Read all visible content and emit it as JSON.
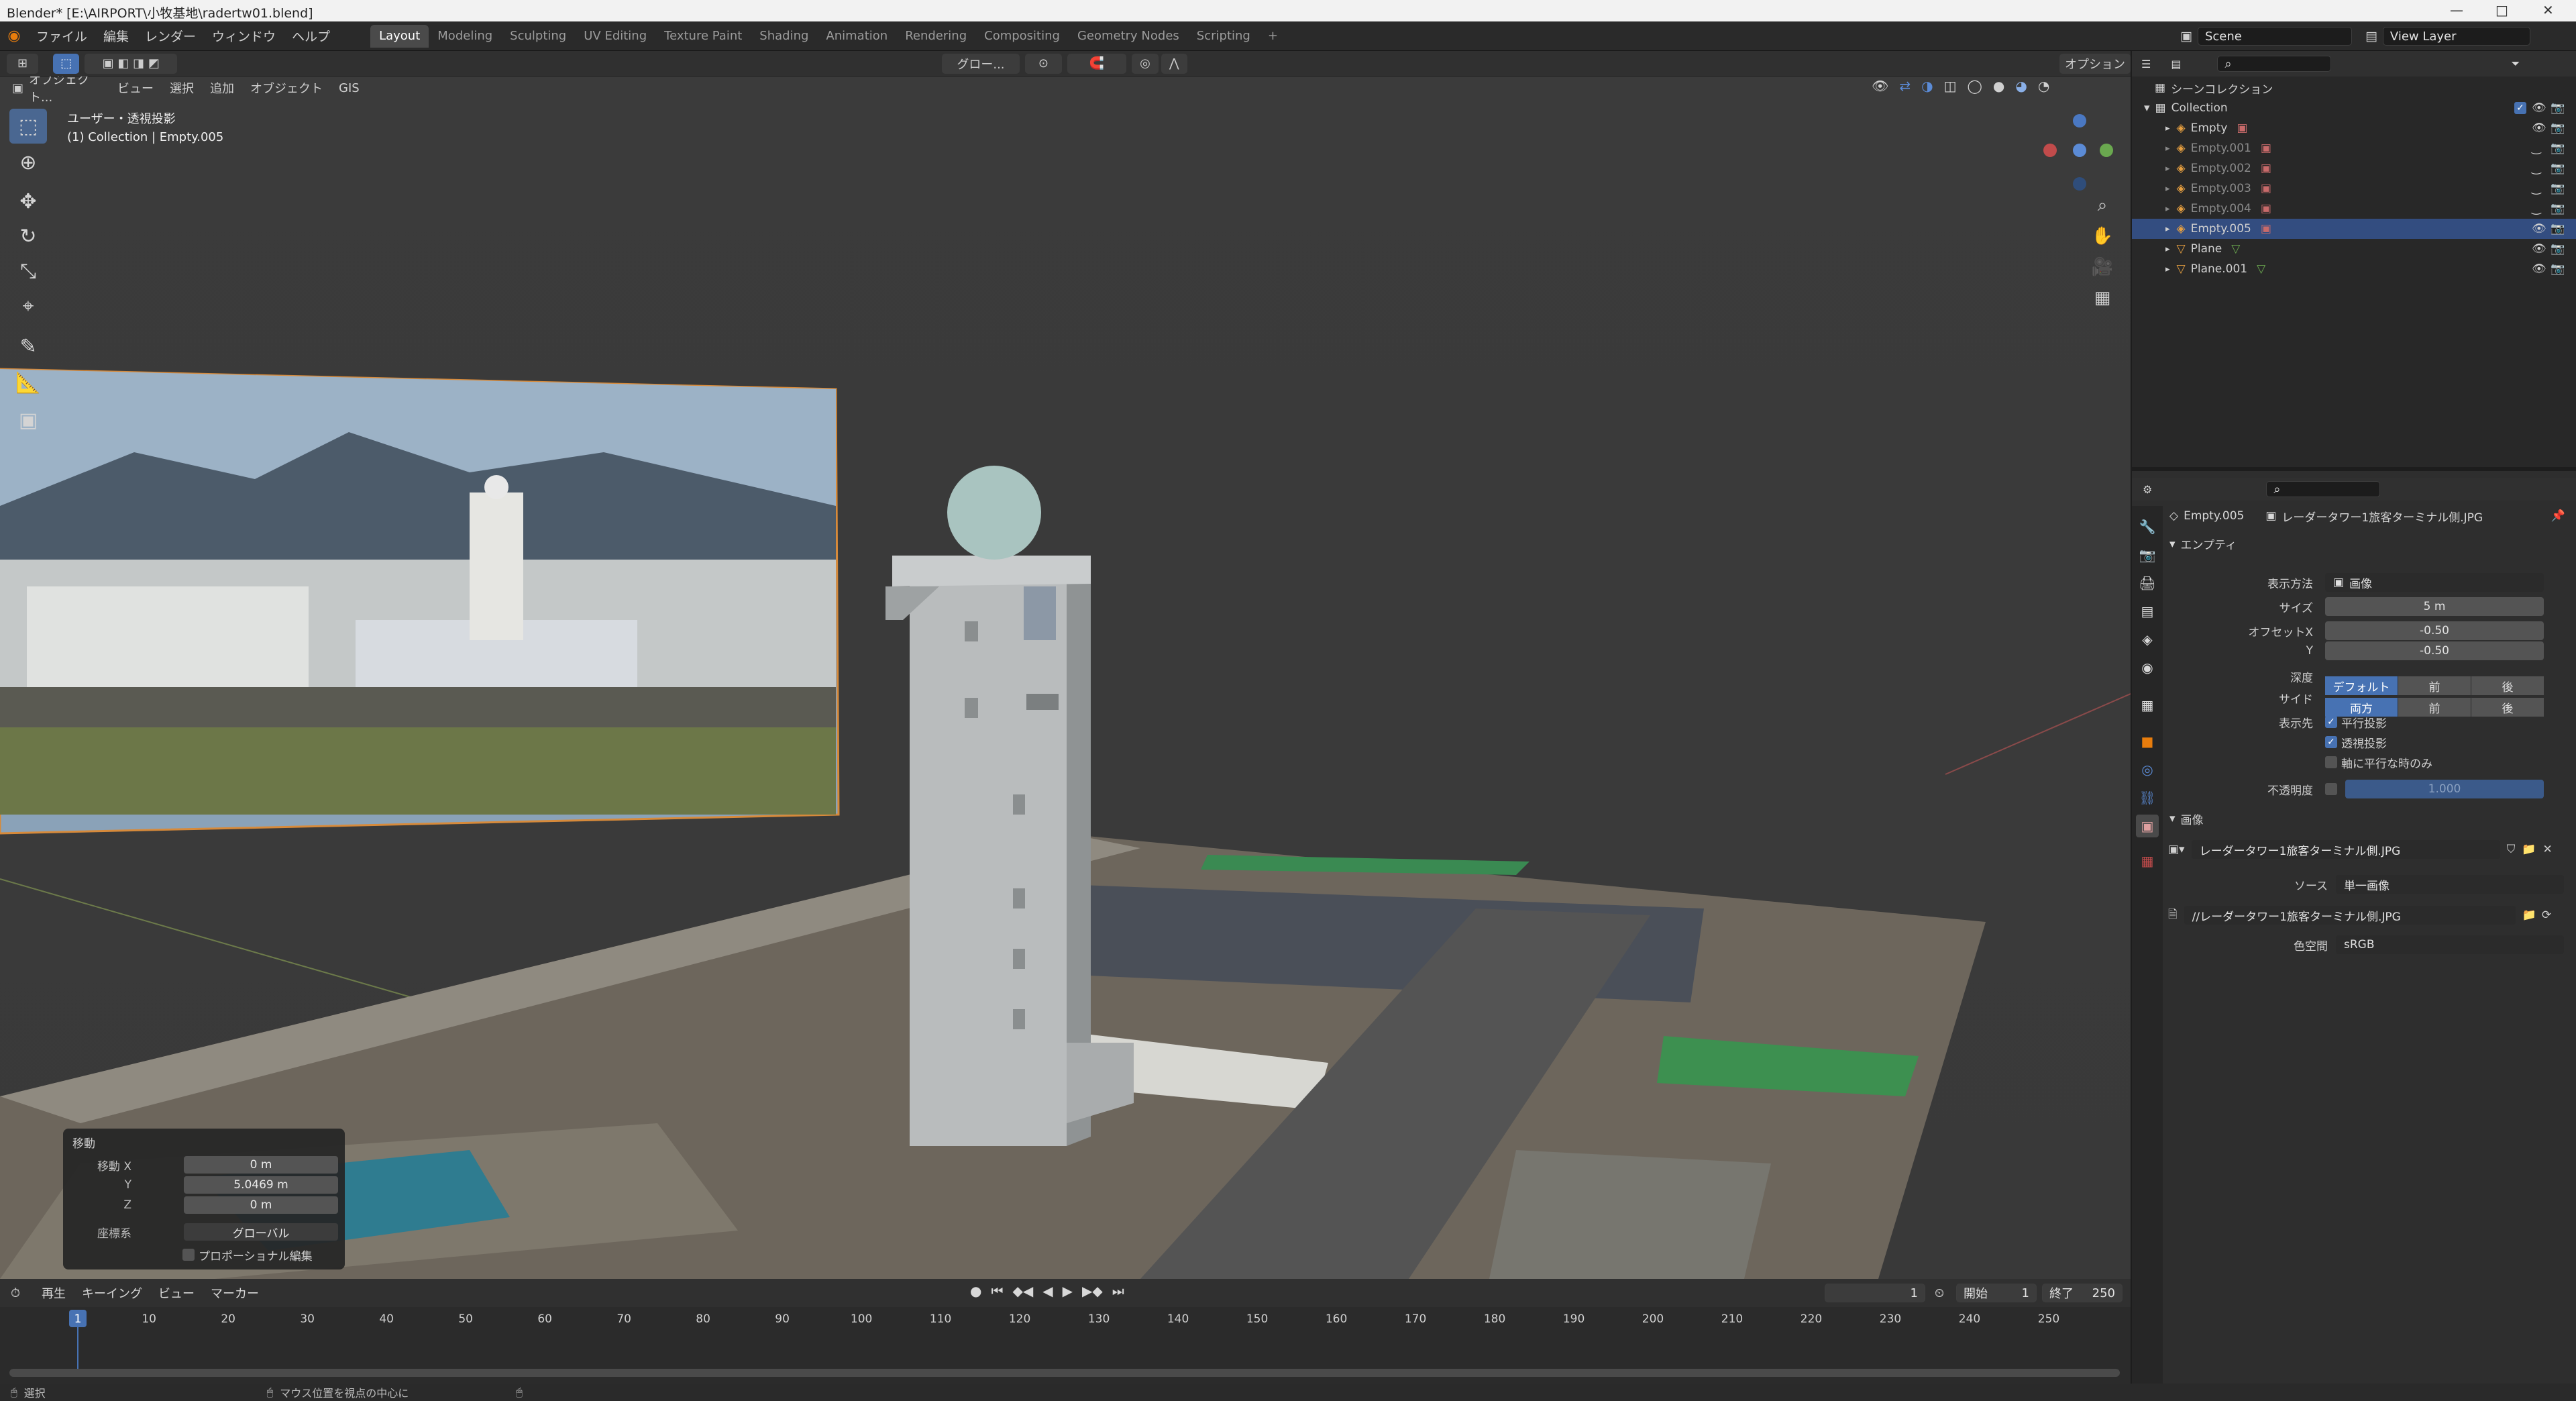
{
  "window": {
    "title": "Blender* [E:\\AIRPORT\\小牧基地\\radertw01.blend]",
    "minimize": "—",
    "maximize": "□",
    "close": "✕"
  },
  "menu": [
    "ファイル",
    "編集",
    "レンダー",
    "ウィンドウ",
    "ヘルプ"
  ],
  "workspaces": [
    "Layout",
    "Modeling",
    "Sculpting",
    "UV Editing",
    "Texture Paint",
    "Shading",
    "Animation",
    "Rendering",
    "Compositing",
    "Geometry Nodes",
    "Scripting"
  ],
  "workspace_add": "+",
  "scene": {
    "name": "Scene",
    "view_layer": "View Layer"
  },
  "header": {
    "transform_orientation": "グロー...",
    "options": "オプション"
  },
  "viewport_header": {
    "mode": "オブジェクト...",
    "menus": [
      "ビュー",
      "選択",
      "追加",
      "オブジェクト",
      "GIS"
    ]
  },
  "viewport": {
    "view_name": "ユーザー・透視投影",
    "collection_info": "(1) Collection | Empty.005",
    "tools": [
      "select",
      "cursor",
      "move",
      "rotate",
      "scale",
      "transform",
      "annotate",
      "measure",
      "add-cube"
    ]
  },
  "operator_panel": {
    "title": "移動",
    "rows": [
      {
        "label": "移動 X",
        "value": "0 m"
      },
      {
        "label": "Y",
        "value": "5.0469 m"
      },
      {
        "label": "Z",
        "value": "0 m"
      }
    ],
    "orientation_label": "座標系",
    "orientation_value": "グローバル",
    "proportional_label": "プロポーショナル編集"
  },
  "outliner": {
    "scene_collection": "シーンコレクション",
    "collection": "Collection",
    "items": [
      {
        "name": "Empty",
        "selected": false,
        "dim": false
      },
      {
        "name": "Empty.001",
        "selected": false,
        "dim": true
      },
      {
        "name": "Empty.002",
        "selected": false,
        "dim": true
      },
      {
        "name": "Empty.003",
        "selected": false,
        "dim": true
      },
      {
        "name": "Empty.004",
        "selected": false,
        "dim": true
      },
      {
        "name": "Empty.005",
        "selected": true,
        "dim": false
      },
      {
        "name": "Plane",
        "selected": false,
        "dim": false
      },
      {
        "name": "Plane.001",
        "selected": false,
        "dim": false
      }
    ]
  },
  "properties": {
    "object_name": "Empty.005",
    "image_name": "レーダータワー1旅客ターミナル側.JPG",
    "empty_section": "エンプティ",
    "display_as_label": "表示方法",
    "display_as_value": "画像",
    "size_label": "サイズ",
    "size_value": "5 m",
    "offset_x_label": "オフセットX",
    "offset_x_value": "-0.50",
    "offset_y_label": "Y",
    "offset_y_value": "-0.50",
    "depth_label": "深度",
    "depth_options": [
      "デフォルト",
      "前",
      "後"
    ],
    "side_label": "サイド",
    "side_options": [
      "両方",
      "前",
      "後"
    ],
    "show_label": "表示先",
    "show_options": [
      {
        "label": "平行投影",
        "checked": true
      },
      {
        "label": "透視投影",
        "checked": true
      },
      {
        "label": "軸に平行な時のみ",
        "checked": false
      }
    ],
    "opacity_label": "不透明度",
    "opacity_value": "1.000",
    "image_section": "画像",
    "image_block_name": "レーダータワー1旅客ターミナル側.JPG",
    "source_label": "ソース",
    "source_value": "単一画像",
    "filepath": "//レーダータワー1旅客ターミナル側.JPG",
    "colorspace_label": "色空間",
    "colorspace_value": "sRGB"
  },
  "timeline": {
    "menus": [
      "再生",
      "キーイング",
      "ビュー",
      "マーカー"
    ],
    "current_frame": "1",
    "start_label": "開始",
    "start_value": "1",
    "end_label": "終了",
    "end_value": "250",
    "ticks": [
      "1",
      "10",
      "20",
      "30",
      "40",
      "50",
      "60",
      "70",
      "80",
      "90",
      "100",
      "110",
      "120",
      "130",
      "140",
      "150",
      "160",
      "170",
      "180",
      "190",
      "200",
      "210",
      "220",
      "230",
      "240",
      "250"
    ]
  },
  "status": {
    "select": "選択",
    "center_view": "マウス位置を視点の中心に"
  }
}
